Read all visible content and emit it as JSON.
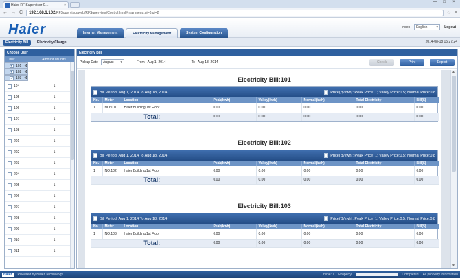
{
  "browser": {
    "tab_title": "Haier RF Supervisor C...",
    "tab_close": "×",
    "back": "←",
    "forward": "→",
    "reload": "C",
    "url_host": "192.168.1.102",
    "url_path": "/RFSupervisor/web/RFSupervisor/Control.html#mainmenu.ui=0.ui=2",
    "star": "☆",
    "menu": "≡",
    "min": "—",
    "max": "□",
    "close": "×"
  },
  "header": {
    "logo": "Haier",
    "nav": [
      {
        "label": "Internet Management"
      },
      {
        "label": "Electricity Management"
      },
      {
        "label": "System Configuration"
      }
    ],
    "user": "Index",
    "language": "English",
    "logout": "Logout"
  },
  "subnav": {
    "tabs": [
      {
        "label": "Electricity Bill"
      },
      {
        "label": "Electricity Charge"
      }
    ],
    "datetime": "2014-08-18 15:27:24"
  },
  "left": {
    "title": "Choose User",
    "col_user": "User",
    "col_amount": "Amount of units",
    "users": [
      {
        "name": "101",
        "amount": "1",
        "checked": "✔"
      },
      {
        "name": "102",
        "amount": "1",
        "checked": "✔"
      },
      {
        "name": "103",
        "amount": "1",
        "checked": "✔"
      },
      {
        "name": "104",
        "amount": "1",
        "checked": ""
      },
      {
        "name": "105",
        "amount": "1",
        "checked": ""
      },
      {
        "name": "106",
        "amount": "1",
        "checked": ""
      },
      {
        "name": "107",
        "amount": "1",
        "checked": ""
      },
      {
        "name": "108",
        "amount": "1",
        "checked": ""
      },
      {
        "name": "201",
        "amount": "1",
        "checked": ""
      },
      {
        "name": "202",
        "amount": "1",
        "checked": ""
      },
      {
        "name": "203",
        "amount": "1",
        "checked": ""
      },
      {
        "name": "204",
        "amount": "1",
        "checked": ""
      },
      {
        "name": "205",
        "amount": "1",
        "checked": ""
      },
      {
        "name": "206",
        "amount": "1",
        "checked": ""
      },
      {
        "name": "207",
        "amount": "1",
        "checked": ""
      },
      {
        "name": "208",
        "amount": "1",
        "checked": ""
      },
      {
        "name": "209",
        "amount": "1",
        "checked": ""
      },
      {
        "name": "210",
        "amount": "1",
        "checked": ""
      },
      {
        "name": "211",
        "amount": "1",
        "checked": ""
      }
    ]
  },
  "main": {
    "title": "Electricity Bill",
    "pickup_label": "Pickup Date",
    "pickup_value": "August",
    "from_label": "From",
    "from_value": "Aug 1, 2014",
    "to_label": "To",
    "to_value": "Aug 18, 2014",
    "btn_check": "Check",
    "btn_print": "Print",
    "btn_export": "Export",
    "columns": [
      "No.",
      "Meter",
      "Location",
      "Peak(kwh)",
      "Valley(kwh)",
      "Normal(kwh)",
      "Total Electricity",
      "Bill($)"
    ],
    "total_label": "Total:",
    "bills": [
      {
        "title": "Electricity Bill:101",
        "period": "Bill Period: Aug 1, 2014 To Aug 18, 2014",
        "price": "Price( $/kwh): Peak Price: 1; Valley Price:0.5; Normal Price:0.8",
        "rows": [
          [
            "1",
            "NO:101",
            "Haier Building/1st Floor",
            "0.00",
            "0.00",
            "0.00",
            "0.00",
            "0.00"
          ]
        ],
        "totals": [
          "0.00",
          "0.00",
          "0.00",
          "0.00",
          "0.00"
        ]
      },
      {
        "title": "Electricity Bill:102",
        "period": "Bill Period: Aug 1, 2014 To Aug 18, 2014",
        "price": "Price( $/kwh): Peak Price: 1; Valley Price:0.5; Normal Price:0.8",
        "rows": [
          [
            "1",
            "NO:102",
            "Haier Building/1st Floor",
            "0.00",
            "0.00",
            "0.00",
            "0.00",
            "0.00"
          ]
        ],
        "totals": [
          "0.00",
          "0.00",
          "0.00",
          "0.00",
          "0.00"
        ]
      },
      {
        "title": "Electricity Bill:103",
        "period": "Bill Period: Aug 1, 2014 To Aug 18, 2014",
        "price": "Price( $/kwh): Peak Price: 1; Valley Price:0.5; Normal Price:0.8",
        "rows": [
          [
            "1",
            "NO:103",
            "Haier Building/1st Floor",
            "0.00",
            "0.00",
            "0.00",
            "0.00",
            "0.00"
          ]
        ],
        "totals": [
          "0.00",
          "0.00",
          "0.00",
          "0.00",
          "0.00"
        ]
      }
    ]
  },
  "status": {
    "logo": "Haier",
    "powered": "Powered by Haier Technology",
    "online": "Online: 1",
    "property": "Property:",
    "complete": "Completed",
    "info": "All property information"
  },
  "colors": {
    "brand": "#1a5fb4",
    "header_bar": "#2f609f",
    "table_header": "#6d94c6"
  }
}
